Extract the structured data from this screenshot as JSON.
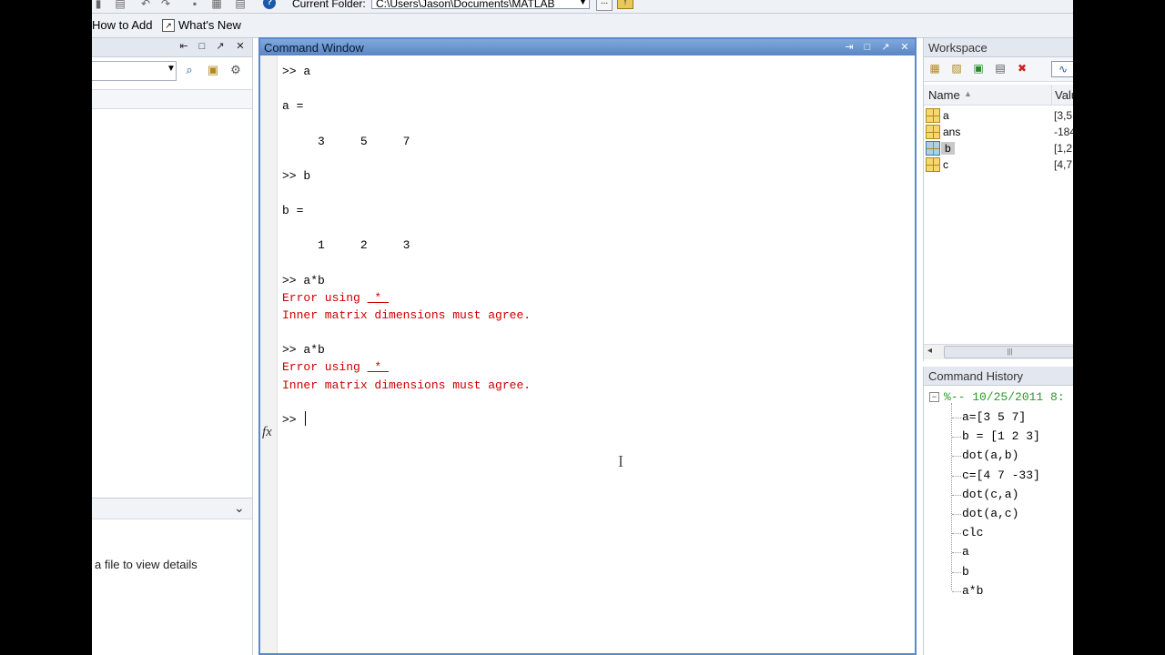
{
  "toolbar": {
    "current_folder_label": "Current Folder:",
    "current_folder_path": "C:\\Users\\Jason\\Documents\\MATLAB",
    "browse_label": "..."
  },
  "shortcuts": {
    "how_to_add": "How to Add",
    "whats_new": "What's New"
  },
  "left_panel": {
    "details_hint": "a file to view details"
  },
  "command_window": {
    "title": "Command Window",
    "lines": [
      {
        "text": ">> a",
        "type": "normal"
      },
      {
        "text": "",
        "type": "normal"
      },
      {
        "text": "a =",
        "type": "normal"
      },
      {
        "text": "",
        "type": "normal"
      },
      {
        "text": "     3     5     7",
        "type": "normal"
      },
      {
        "text": "",
        "type": "normal"
      },
      {
        "text": ">> b",
        "type": "normal"
      },
      {
        "text": "",
        "type": "normal"
      },
      {
        "text": "b =",
        "type": "normal"
      },
      {
        "text": "",
        "type": "normal"
      },
      {
        "text": "     1     2     3",
        "type": "normal"
      },
      {
        "text": "",
        "type": "normal"
      },
      {
        "text": ">> a*b",
        "type": "normal"
      },
      {
        "text": "Error using ",
        "link": " * ",
        "type": "error"
      },
      {
        "text": "Inner matrix dimensions must agree.",
        "type": "error"
      },
      {
        "text": "",
        "type": "normal"
      },
      {
        "text": ">> a*b",
        "type": "normal"
      },
      {
        "text": "Error using ",
        "link": " * ",
        "type": "error"
      },
      {
        "text": "Inner matrix dimensions must agree.",
        "type": "error"
      },
      {
        "text": "",
        "type": "normal"
      }
    ],
    "prompt": ">> ",
    "fx_label": "fx"
  },
  "workspace": {
    "title": "Workspace",
    "col_name": "Name",
    "col_value": "Valu",
    "variables": [
      {
        "name": "a",
        "value": "[3,5,",
        "icon": "matrix-icon",
        "selected": false
      },
      {
        "name": "ans",
        "value": "-184",
        "icon": "matrix-icon",
        "selected": false
      },
      {
        "name": "b",
        "value": "[1,2,",
        "icon": "matrix-icon",
        "selected": true
      },
      {
        "name": "c",
        "value": "[4,7,",
        "icon": "matrix-icon",
        "selected": false
      }
    ]
  },
  "command_history": {
    "title": "Command History",
    "session": "%-- 10/25/2011 8:",
    "items": [
      "a=[3 5 7]",
      "b = [1 2 3]",
      "dot(a,b)",
      "c=[4 7 -33]",
      "dot(c,a)",
      "dot(a,c)",
      "clc",
      "a",
      "b",
      "a*b"
    ]
  },
  "colors": {
    "error": "#cc0000",
    "history_session": "#2a9a2a",
    "title_active": "#5b86c5"
  }
}
